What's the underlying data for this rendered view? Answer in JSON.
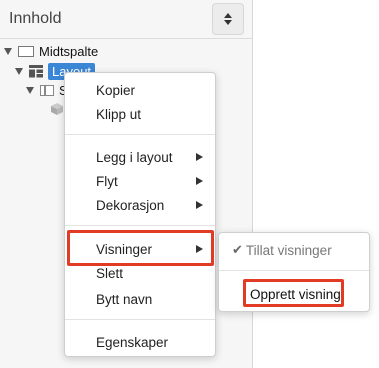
{
  "panel": {
    "title": "Innhold",
    "sort_icon": "sort-updown-icon"
  },
  "tree": {
    "root_label": "Midtspalte",
    "layout_label": "Layout",
    "child_label": "S"
  },
  "context_menu": {
    "items": {
      "copy": "Kopier",
      "cut": "Klipp ut",
      "add_to_layout": "Legg i layout",
      "move": "Flyt",
      "decoration": "Dekorasjon",
      "views": "Visninger",
      "delete": "Slett",
      "rename": "Bytt navn",
      "properties": "Egenskaper"
    }
  },
  "submenu": {
    "allow_views": "Tillat visninger",
    "create_view": "Opprett visning"
  },
  "colors": {
    "highlight": "#e23b25",
    "selected": "#3b86d6"
  }
}
